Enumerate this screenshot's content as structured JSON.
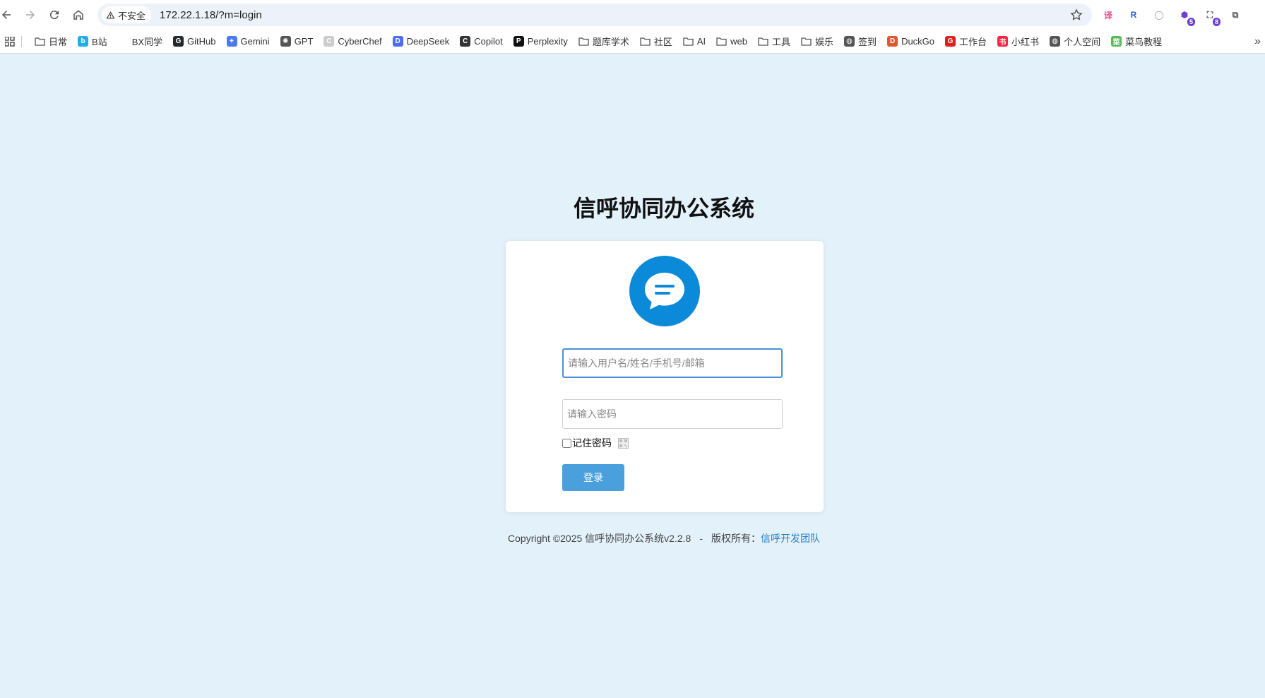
{
  "browser": {
    "security_label": "不安全",
    "url": "172.22.1.18/?m=login",
    "extensions": [
      {
        "name": "translate-extension-icon",
        "glyph": "译",
        "color": "#e84c8b"
      },
      {
        "name": "reader-extension-icon",
        "glyph": "R",
        "color": "#2a5fc9"
      },
      {
        "name": "circle-extension-icon",
        "glyph": "◯",
        "color": "#999999"
      },
      {
        "name": "shield-extension-icon",
        "glyph": "⬢",
        "color": "#6b3fd6",
        "badge": "5"
      },
      {
        "name": "capture-extension-icon",
        "glyph": "⛶",
        "color": "#555555",
        "badge": "8"
      },
      {
        "name": "puzzle-extension-icon",
        "glyph": "⧉",
        "color": "#555555"
      }
    ]
  },
  "bookmarks": [
    {
      "label": "日常",
      "type": "folder"
    },
    {
      "label": "B站",
      "type": "site",
      "color": "#23ade5",
      "glyph": "b"
    },
    {
      "label": "BX同学",
      "type": "site",
      "color": "#ffffff",
      "glyph": ""
    },
    {
      "label": "GitHub",
      "type": "site",
      "color": "#24292e",
      "glyph": "G"
    },
    {
      "label": "Gemini",
      "type": "site",
      "color": "#4b7bec",
      "glyph": "✦"
    },
    {
      "label": "GPT",
      "type": "site",
      "color": "#555555",
      "glyph": "✺"
    },
    {
      "label": "CyberChef",
      "type": "site",
      "color": "#cccccc",
      "glyph": "C"
    },
    {
      "label": "DeepSeek",
      "type": "site",
      "color": "#4d6bfe",
      "glyph": "D"
    },
    {
      "label": "Copilot",
      "type": "site",
      "color": "#333333",
      "glyph": "C"
    },
    {
      "label": "Perplexity",
      "type": "site",
      "color": "#111111",
      "glyph": "P"
    },
    {
      "label": "题库学术",
      "type": "folder"
    },
    {
      "label": "社区",
      "type": "folder"
    },
    {
      "label": "AI",
      "type": "folder"
    },
    {
      "label": "web",
      "type": "folder"
    },
    {
      "label": "工具",
      "type": "folder"
    },
    {
      "label": "娱乐",
      "type": "folder"
    },
    {
      "label": "签到",
      "type": "site",
      "color": "#555555",
      "glyph": "◍"
    },
    {
      "label": "DuckGo",
      "type": "site",
      "color": "#de5833",
      "glyph": "D"
    },
    {
      "label": "工作台",
      "type": "site",
      "color": "#e02020",
      "glyph": "G"
    },
    {
      "label": "小红书",
      "type": "site",
      "color": "#ff2442",
      "glyph": "书"
    },
    {
      "label": "个人空间",
      "type": "site",
      "color": "#555555",
      "glyph": "◍"
    },
    {
      "label": "菜鸟教程",
      "type": "site",
      "color": "#5cb85c",
      "glyph": "菜"
    }
  ],
  "login": {
    "title": "信呼协同办公系统",
    "username_placeholder": "请输入用户名/姓名/手机号/邮箱",
    "password_placeholder": "请输入密码",
    "remember_label": "记住密码",
    "login_button": "登录",
    "brand_color": "#0a8ad8"
  },
  "footer": {
    "copyright": "Copyright ©2025 信呼协同办公系统v2.2.8",
    "separator": "-",
    "rights_label": "版权所有：",
    "team_link": "信呼开发团队"
  }
}
